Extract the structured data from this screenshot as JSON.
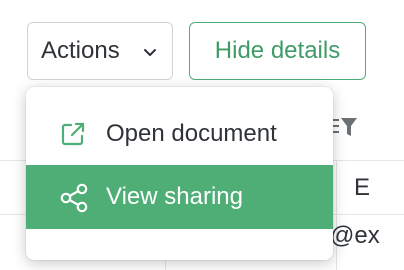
{
  "toolbar": {
    "actions_label": "Actions",
    "hide_details_label": "Hide details"
  },
  "table": {
    "column_header_partial": "E",
    "cell_partial": "@ex"
  },
  "menu": {
    "items": [
      {
        "label": "Open document",
        "icon": "external-link-icon"
      },
      {
        "label": "View sharing",
        "icon": "share-icon",
        "highlighted": true
      }
    ]
  },
  "colors": {
    "accent": "#4fae76",
    "accent_text": "#3f9c66",
    "text": "#2f3338",
    "border": "#d0d4d8"
  }
}
